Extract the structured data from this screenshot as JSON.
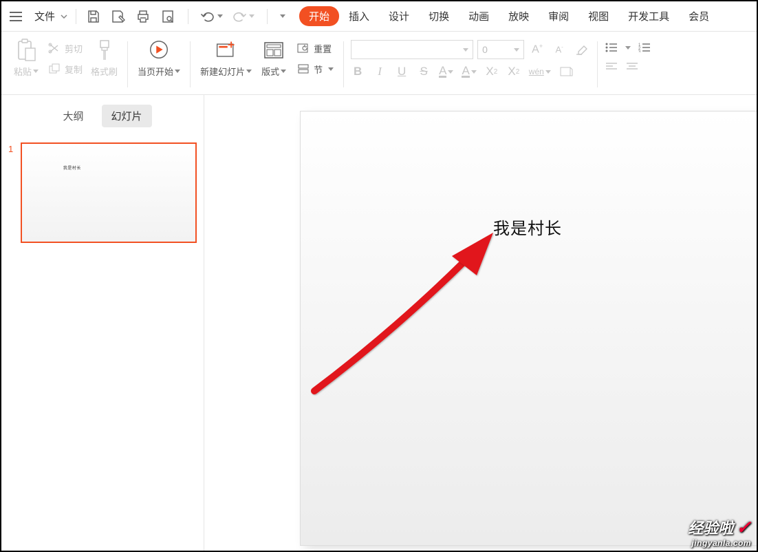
{
  "topbar": {
    "file_label": "文件",
    "tabs": [
      "开始",
      "插入",
      "设计",
      "切换",
      "动画",
      "放映",
      "审阅",
      "视图",
      "开发工具",
      "会员"
    ]
  },
  "ribbon": {
    "paste_label": "粘贴",
    "cut_label": "剪切",
    "copy_label": "复制",
    "format_painter_label": "格式刷",
    "from_current_label": "当页开始",
    "new_slide_label": "新建幻灯片",
    "layout_label": "版式",
    "section_label": "节",
    "reset_label": "重置",
    "font_size_value": "0",
    "pinyin_label": "wén"
  },
  "sidebar": {
    "tabs": {
      "outline": "大纲",
      "slides": "幻灯片"
    },
    "thumbs": [
      {
        "num": "1",
        "preview_text": "我是村长"
      }
    ]
  },
  "slide": {
    "text": "我是村长"
  },
  "watermark": {
    "line1": "经验啦",
    "line2": "jingyanla.com"
  }
}
